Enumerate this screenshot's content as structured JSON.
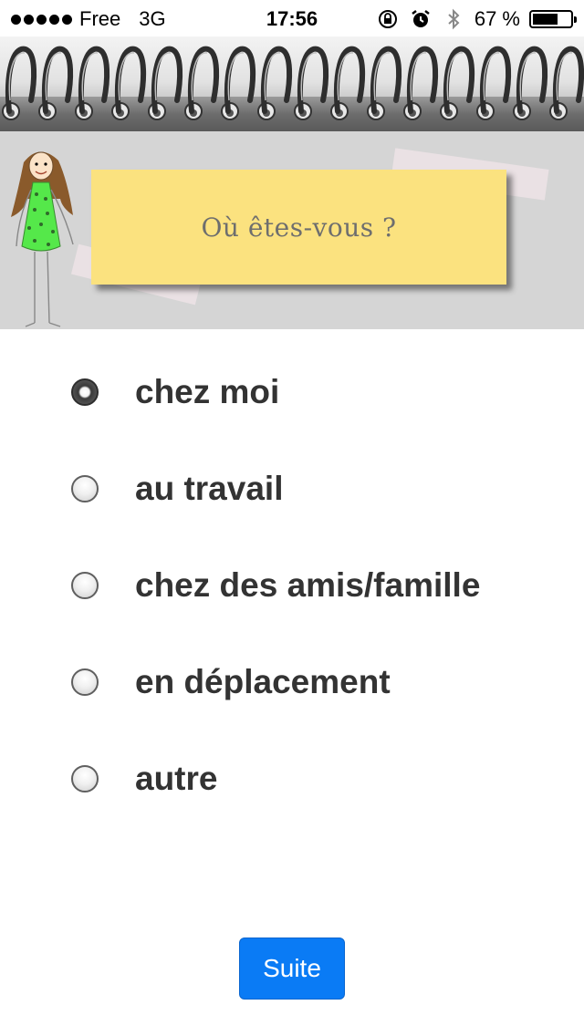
{
  "status_bar": {
    "carrier": "Free",
    "network": "3G",
    "time": "17:56",
    "battery_percent": "67 %",
    "battery_level": 0.67,
    "icons": [
      "signal-dots-icon",
      "orientation-lock-icon",
      "alarm-icon",
      "bluetooth-icon",
      "battery-icon"
    ]
  },
  "header": {
    "question": "Où êtes-vous ?",
    "note_color": "#fbe27f"
  },
  "options": [
    {
      "label": "chez moi",
      "checked": true
    },
    {
      "label": "au travail",
      "checked": false
    },
    {
      "label": "chez des amis/famille",
      "checked": false
    },
    {
      "label": "en déplacement",
      "checked": false
    },
    {
      "label": "autre",
      "checked": false
    }
  ],
  "footer": {
    "next_label": "Suite",
    "button_color": "#0a7bf5"
  }
}
